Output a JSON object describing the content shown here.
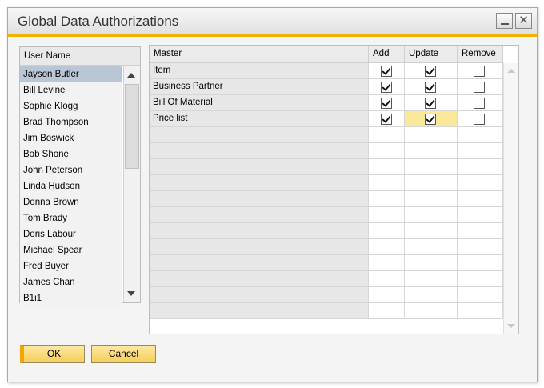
{
  "window": {
    "title": "Global Data Authorizations",
    "minimize_glyph": "",
    "close_glyph": "✕"
  },
  "users": {
    "header": "User Name",
    "selected_index": 0,
    "items": [
      "Jayson Butler",
      "Bill Levine",
      "Sophie Klogg",
      "Brad Thompson",
      "Jim Boswick",
      "Bob Shone",
      "John Peterson",
      "Linda Hudson",
      "Donna Brown",
      "Tom Brady",
      "Doris Labour",
      "Michael Spear",
      "Fred Buyer",
      "James Chan",
      "B1i1"
    ]
  },
  "grid": {
    "columns": {
      "master": "Master",
      "add": "Add",
      "update": "Update",
      "remove": "Remove"
    },
    "rows": [
      {
        "master": "Item",
        "add": true,
        "update": true,
        "remove": false
      },
      {
        "master": "Business Partner",
        "add": true,
        "update": true,
        "remove": false
      },
      {
        "master": "Bill Of Material",
        "add": true,
        "update": true,
        "remove": false
      },
      {
        "master": "Price list",
        "add": true,
        "update": true,
        "remove": false
      }
    ],
    "highlight": {
      "row": 3,
      "column": "update"
    },
    "empty_rows": 12
  },
  "buttons": {
    "ok": "OK",
    "cancel": "Cancel"
  },
  "colors": {
    "accent": "#f1b200",
    "selection": "#b9c6d6",
    "highlight_cell": "#fbe99b",
    "button": "#f6cf59"
  }
}
